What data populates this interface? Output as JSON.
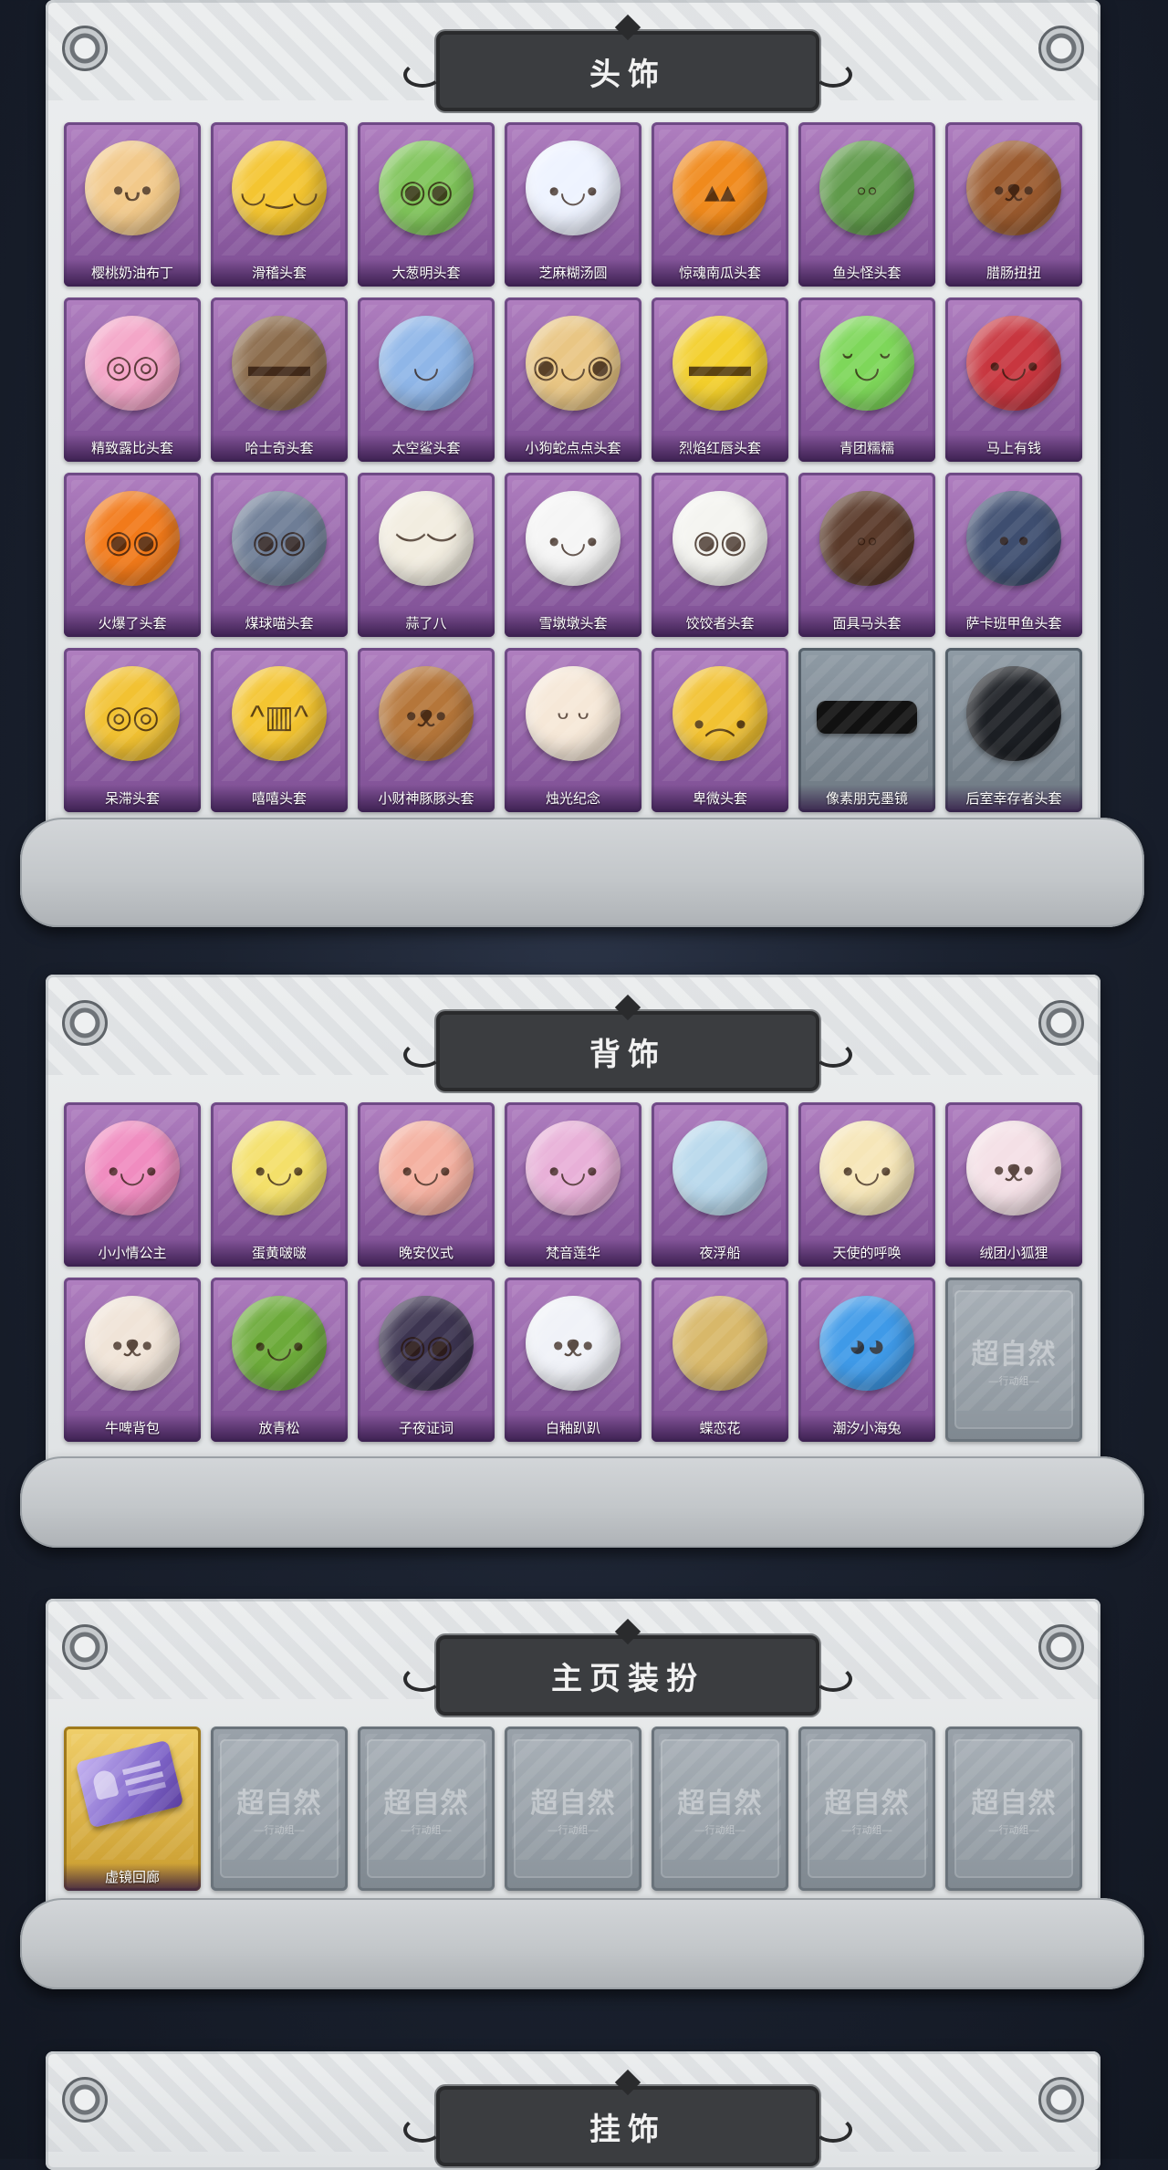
{
  "sections": [
    {
      "id": "head",
      "title": "头饰",
      "items": [
        {
          "label": "樱桃奶油布丁",
          "icon": "pudding-hat-icon",
          "color": "#f2c98a",
          "face": "•ᴗ•"
        },
        {
          "label": "滑稽头套",
          "icon": "smirk-face-icon",
          "color": "#f4c531",
          "face": "◡‿◡"
        },
        {
          "label": "大葱明头套",
          "icon": "scallion-head-icon",
          "color": "#7fc45a",
          "face": "◉◉"
        },
        {
          "label": "芝麻糊汤圆",
          "icon": "rice-ball-icon",
          "color": "#eef3ff",
          "face": "•◡•"
        },
        {
          "label": "惊魂南瓜头套",
          "icon": "pumpkin-head-icon",
          "color": "#f08a1c",
          "face": "▴▴"
        },
        {
          "label": "鱼头怪头套",
          "icon": "fish-head-icon",
          "color": "#5f9a4a",
          "face": "◦◦"
        },
        {
          "label": "腊肠扭扭",
          "icon": "dachshund-head-icon",
          "color": "#9a5a2e",
          "face": "•ᴥ•"
        },
        {
          "label": "精致露比头套",
          "icon": "pink-pig-head-icon",
          "color": "#f4a6c8",
          "face": "◎◎"
        },
        {
          "label": "哈士奇头套",
          "icon": "husky-head-icon",
          "color": "#8a6a4a",
          "face": "▬▬"
        },
        {
          "label": "太空鲨头套",
          "icon": "shark-head-icon",
          "color": "#8fb6e8",
          "face": "◡"
        },
        {
          "label": "小狗蛇点点头套",
          "icon": "snake-head-icon",
          "color": "#e9c684",
          "face": "◉◡◉"
        },
        {
          "label": "烈焰红唇头套",
          "icon": "pikachu-head-icon",
          "color": "#f3cf2c",
          "face": "▬▬"
        },
        {
          "label": "青团糯糯",
          "icon": "green-dumpling-icon",
          "color": "#7ed75a",
          "face": "˘◡˘"
        },
        {
          "label": "马上有钱",
          "icon": "red-horse-head-icon",
          "color": "#c8363f",
          "face": "•◡•"
        },
        {
          "label": "火爆了头套",
          "icon": "fire-head-icon",
          "color": "#f27a1a",
          "face": "◉◉"
        },
        {
          "label": "煤球喵头套",
          "icon": "gray-cat-head-icon",
          "color": "#6e7d96",
          "face": "◉◉"
        },
        {
          "label": "蒜了八",
          "icon": "garlic-head-icon",
          "color": "#f2ede0",
          "face": "︶︶"
        },
        {
          "label": "雪墩墩头套",
          "icon": "snowman-head-icon",
          "color": "#f5f5f5",
          "face": "•◡•"
        },
        {
          "label": "饺饺者头套",
          "icon": "dumpling-head-icon",
          "color": "#f4f4f0",
          "face": "◉◉"
        },
        {
          "label": "面具马头套",
          "icon": "horse-mask-icon",
          "color": "#5a3a2a",
          "face": "◦◦"
        },
        {
          "label": "萨卡班甲鱼头套",
          "icon": "sacabambaspis-head-icon",
          "color": "#3e4e70",
          "face": "• •"
        },
        {
          "label": "呆滞头套",
          "icon": "dazed-face-icon",
          "color": "#f2c232",
          "face": "◎◎"
        },
        {
          "label": "嘻嘻头套",
          "icon": "grin-face-icon",
          "color": "#f4c531",
          "face": "^▥^"
        },
        {
          "label": "小财神豚豚头套",
          "icon": "capybara-head-icon",
          "color": "#b5763a",
          "face": "•ᴥ•"
        },
        {
          "label": "烛光纪念",
          "icon": "candle-head-icon",
          "color": "#f6e8d8",
          "face": "ᵕ ᵕ"
        },
        {
          "label": "卑微头套",
          "icon": "shy-face-icon",
          "color": "#f2c232",
          "face": "•︵•"
        },
        {
          "label": "像素朋克墨镜",
          "icon": "pixel-sunglasses-icon",
          "color": "#111111",
          "face": "",
          "gray": true
        },
        {
          "label": "后室幸存者头套",
          "icon": "gas-mask-helmet-icon",
          "color": "#1c1f24",
          "face": "",
          "gray": true
        }
      ]
    },
    {
      "id": "back",
      "title": "背饰",
      "items": [
        {
          "label": "小小情公主",
          "icon": "princess-doll-icon",
          "color": "#f08cc0",
          "face": "•◡•"
        },
        {
          "label": "蛋黄啵啵",
          "icon": "chick-egg-icon",
          "color": "#f4e06a",
          "face": "•◡•"
        },
        {
          "label": "晚安仪式",
          "icon": "pig-doll-icon",
          "color": "#f4b0a0",
          "face": "•◡•"
        },
        {
          "label": "梵音莲华",
          "icon": "lotus-doll-icon",
          "color": "#e8b0d8",
          "face": "•◡•"
        },
        {
          "label": "夜浮船",
          "icon": "jellyfish-icon",
          "color": "#b8d8ec",
          "face": ""
        },
        {
          "label": "天使的呼唤",
          "icon": "angel-doll-icon",
          "color": "#f6e6b8",
          "face": "•◡•"
        },
        {
          "label": "绒团小狐狸",
          "icon": "fox-plush-icon",
          "color": "#f4e0e6",
          "face": "•ᴥ•"
        },
        {
          "label": "牛啤背包",
          "icon": "cow-barrel-icon",
          "color": "#f0e4d8",
          "face": "•ᴥ•"
        },
        {
          "label": "放青松",
          "icon": "bonsai-pot-icon",
          "color": "#6caa3a",
          "face": "•◡•"
        },
        {
          "label": "子夜证词",
          "icon": "owl-doll-icon",
          "color": "#3c3450",
          "face": "◉◉"
        },
        {
          "label": "白釉趴趴",
          "icon": "white-ferret-icon",
          "color": "#f0f2f8",
          "face": "•ᴥ•"
        },
        {
          "label": "蝶恋花",
          "icon": "bell-ornament-icon",
          "color": "#d8b86a",
          "face": ""
        },
        {
          "label": "潮汐小海兔",
          "icon": "blue-sea-bunny-icon",
          "color": "#3f9ae8",
          "face": "◕◕"
        },
        {
          "label": "",
          "icon": "locked-placeholder-icon",
          "color": "",
          "face": "",
          "empty": true
        }
      ]
    },
    {
      "id": "home",
      "title": "主页装扮",
      "items": [
        {
          "label": "虚镜回廊",
          "icon": "purple-ticket-icon",
          "color": "#7f65c9",
          "face": "",
          "gold": true
        },
        {
          "label": "",
          "icon": "locked-placeholder-icon",
          "color": "",
          "face": "",
          "empty": true
        },
        {
          "label": "",
          "icon": "locked-placeholder-icon",
          "color": "",
          "face": "",
          "empty": true
        },
        {
          "label": "",
          "icon": "locked-placeholder-icon",
          "color": "",
          "face": "",
          "empty": true
        },
        {
          "label": "",
          "icon": "locked-placeholder-icon",
          "color": "",
          "face": "",
          "empty": true
        },
        {
          "label": "",
          "icon": "locked-placeholder-icon",
          "color": "",
          "face": "",
          "empty": true
        },
        {
          "label": "",
          "icon": "locked-placeholder-icon",
          "color": "",
          "face": "",
          "empty": true
        }
      ]
    },
    {
      "id": "pendant",
      "title": "挂饰",
      "items": []
    }
  ],
  "placeholder": {
    "logo": "超自然",
    "sub": "—行动组—"
  },
  "colors": {
    "purple_card": "#9b6cb0",
    "gray_card": "#7c8790",
    "gold_card": "#d9ae3e",
    "banner": "#3b3d40"
  }
}
